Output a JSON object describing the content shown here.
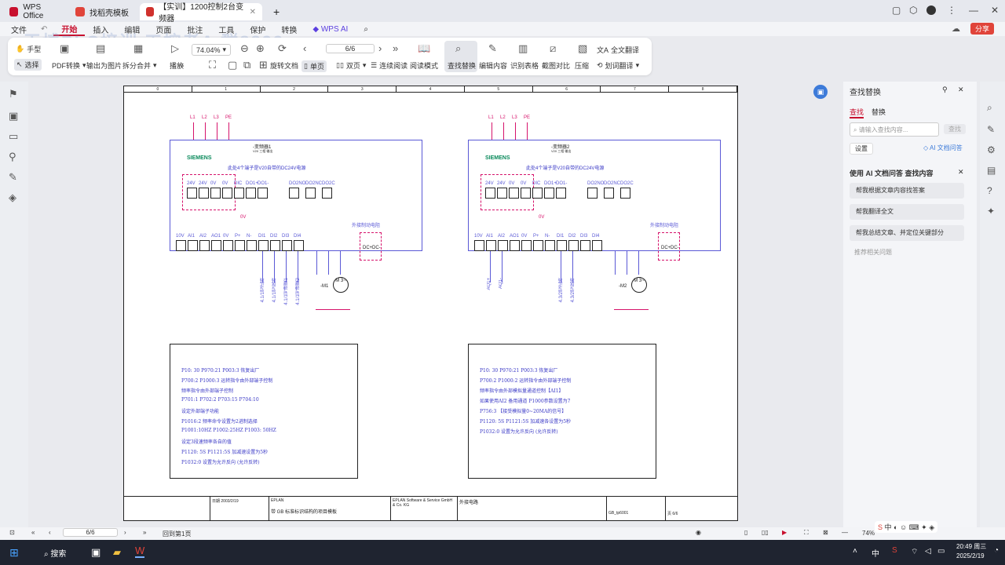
{
  "titlebar": {
    "app_tab": "WPS Office",
    "tab2": "找稻壳模板",
    "tab3": "【实训】1200控制2台变频器",
    "new_tab": "+"
  },
  "menubar": {
    "file": "文件",
    "items": [
      "开始",
      "插入",
      "编辑",
      "页面",
      "批注",
      "工具",
      "保护",
      "转换"
    ],
    "ai": "WPS AI",
    "share": "分享"
  },
  "toolbar": {
    "hand": "手型",
    "select": "选择",
    "pdf_convert": "PDF转换",
    "export_image": "输出为图片",
    "split_merge": "拆分合并",
    "play": "播放",
    "zoom": "74.04%",
    "page": "6/6",
    "rotate": "旋转文档",
    "single": "单页",
    "double": "双页",
    "continuous": "连续阅读",
    "read_mode": "阅读模式",
    "find_replace": "查找替换",
    "edit_content": "编辑内容",
    "recognize_table": "识别表格",
    "screenshot_compare": "截图对比",
    "compress": "压缩",
    "full_translate": "全文翻译",
    "word_translate": "划词翻译"
  },
  "watermark": "天博PLC培训 工控老A 群8899",
  "diagram": {
    "left": {
      "supply": [
        "L1",
        "L2",
        "L3",
        "PE"
      ],
      "device_label": "-变频器1",
      "device_sub": "V20 三相 输出",
      "brand": "SIEMENS",
      "note": "此处4个端子是V20自带的DC24V电源",
      "top_terms": [
        "24V",
        "24V",
        "0V",
        "0V",
        "DIC",
        "DO1+",
        "DO1-"
      ],
      "relay_terms": [
        "DO2NO",
        "DO2NC",
        "DO2C"
      ],
      "bottom_terms": [
        "10V",
        "AI1",
        "AI2",
        "AO1",
        "0V",
        "P+",
        "N-",
        "DI1",
        "DI2",
        "DI3",
        "DI4"
      ],
      "zero_v": "0V",
      "brake": "外接制动电阻",
      "dc": [
        "DC+",
        "DC-"
      ],
      "inputs": [
        "4.1/1号正转",
        "4.1/1号反转",
        "4.1/1号速度1",
        "4.1/1号速度2"
      ],
      "motor_label": "-M1",
      "motor": "M 3~"
    },
    "right": {
      "supply": [
        "L1",
        "L2",
        "L3",
        "PE"
      ],
      "device_label": "-变频器2",
      "device_sub": "V20 三相 输出",
      "brand": "SIEMENS",
      "note": "此处4个端子是V20自带的DC24V电源",
      "top_terms": [
        "24V",
        "24V",
        "0V",
        "0V",
        "DIC",
        "DO1+",
        "DO1-"
      ],
      "relay_terms": [
        "DO2NO",
        "DO2NC",
        "DO2C"
      ],
      "bottom_terms": [
        "10V",
        "AI1",
        "AI2",
        "AO1",
        "0V",
        "P+",
        "N-",
        "DI1",
        "DI2",
        "DI3",
        "DI4"
      ],
      "zero_v": "0V",
      "brake": "外接制动电阻",
      "dc": [
        "DC+",
        "DC-"
      ],
      "inputs": [
        "AQ1+",
        "AQ1-",
        "4.3/2号正转",
        "4.3/2号反转"
      ],
      "motor_label": "-M2",
      "motor": "M 3~"
    },
    "params_left": [
      "P10: 30        P970:21        P003:3    恢复出厂",
      "P700:2        P1000:3        运转指令由外部端子控制",
      "频率指令由外部端子控制",
      "P701:1        P702:2        P703:15        P704:10",
      "设定外部端子功能",
      "P1016:2        频率命令设置为2进制选择",
      "P1001:10HZ        P1002:25HZ        P1003: 50HZ",
      "设定3段速频率各自的值",
      "P1120: 5S        P1121:5S        加减速设置为5秒",
      "P1032:0    设置为允许反向 (允许反转)"
    ],
    "params_right": [
      "P10: 30        P970:21        P003:3    恢复出厂",
      "P700:2        P1000:2        运转指令由外部端子控制",
      "频率指令由外部模拟量通道控制【AI1】",
      "如果使用AI2 备用通道   P1000参数设置为7",
      "P756:3   【接受模拟量0~20MA的信号】",
      "P1120: 5S        P1121:5S        加减速各设置为5秒",
      "P1032:0    设置为允许反向 (允许反转)"
    ],
    "footer": {
      "date_label": "日期",
      "date": "2003/2/19",
      "check": "EPLAN",
      "project": "带 GB 标准标识结构的项目模板",
      "company": "EPLAN Software & Service GmbH & Co. KG",
      "title": "外接电路",
      "doc": "GB_tp6001",
      "page_label": "页",
      "page": "6/6",
      "ruler_nums": [
        "0",
        "1",
        "2",
        "3",
        "4",
        "5",
        "6",
        "7",
        "8"
      ]
    }
  },
  "rightpanel": {
    "title": "查找替换",
    "tab_find": "查找",
    "tab_replace": "替换",
    "search_placeholder": "请输入查找内容...",
    "search_btn": "查找",
    "settings": "设置",
    "ai_link": "AI 文档问答",
    "ai_header": "使用  AI 文档问答 查找内容",
    "suggestions": [
      "帮我根据文章内容找答案",
      "帮我翻译全文",
      "帮我总结文章、并定位关键部分"
    ],
    "related": "推荐相关问题"
  },
  "statusbar": {
    "page": "6/6",
    "goto": "回到第1页",
    "zoom": "74%"
  },
  "taskbar": {
    "search": "搜索",
    "time": "20:49 周三",
    "date": "2025/2/19",
    "ime": "中"
  }
}
